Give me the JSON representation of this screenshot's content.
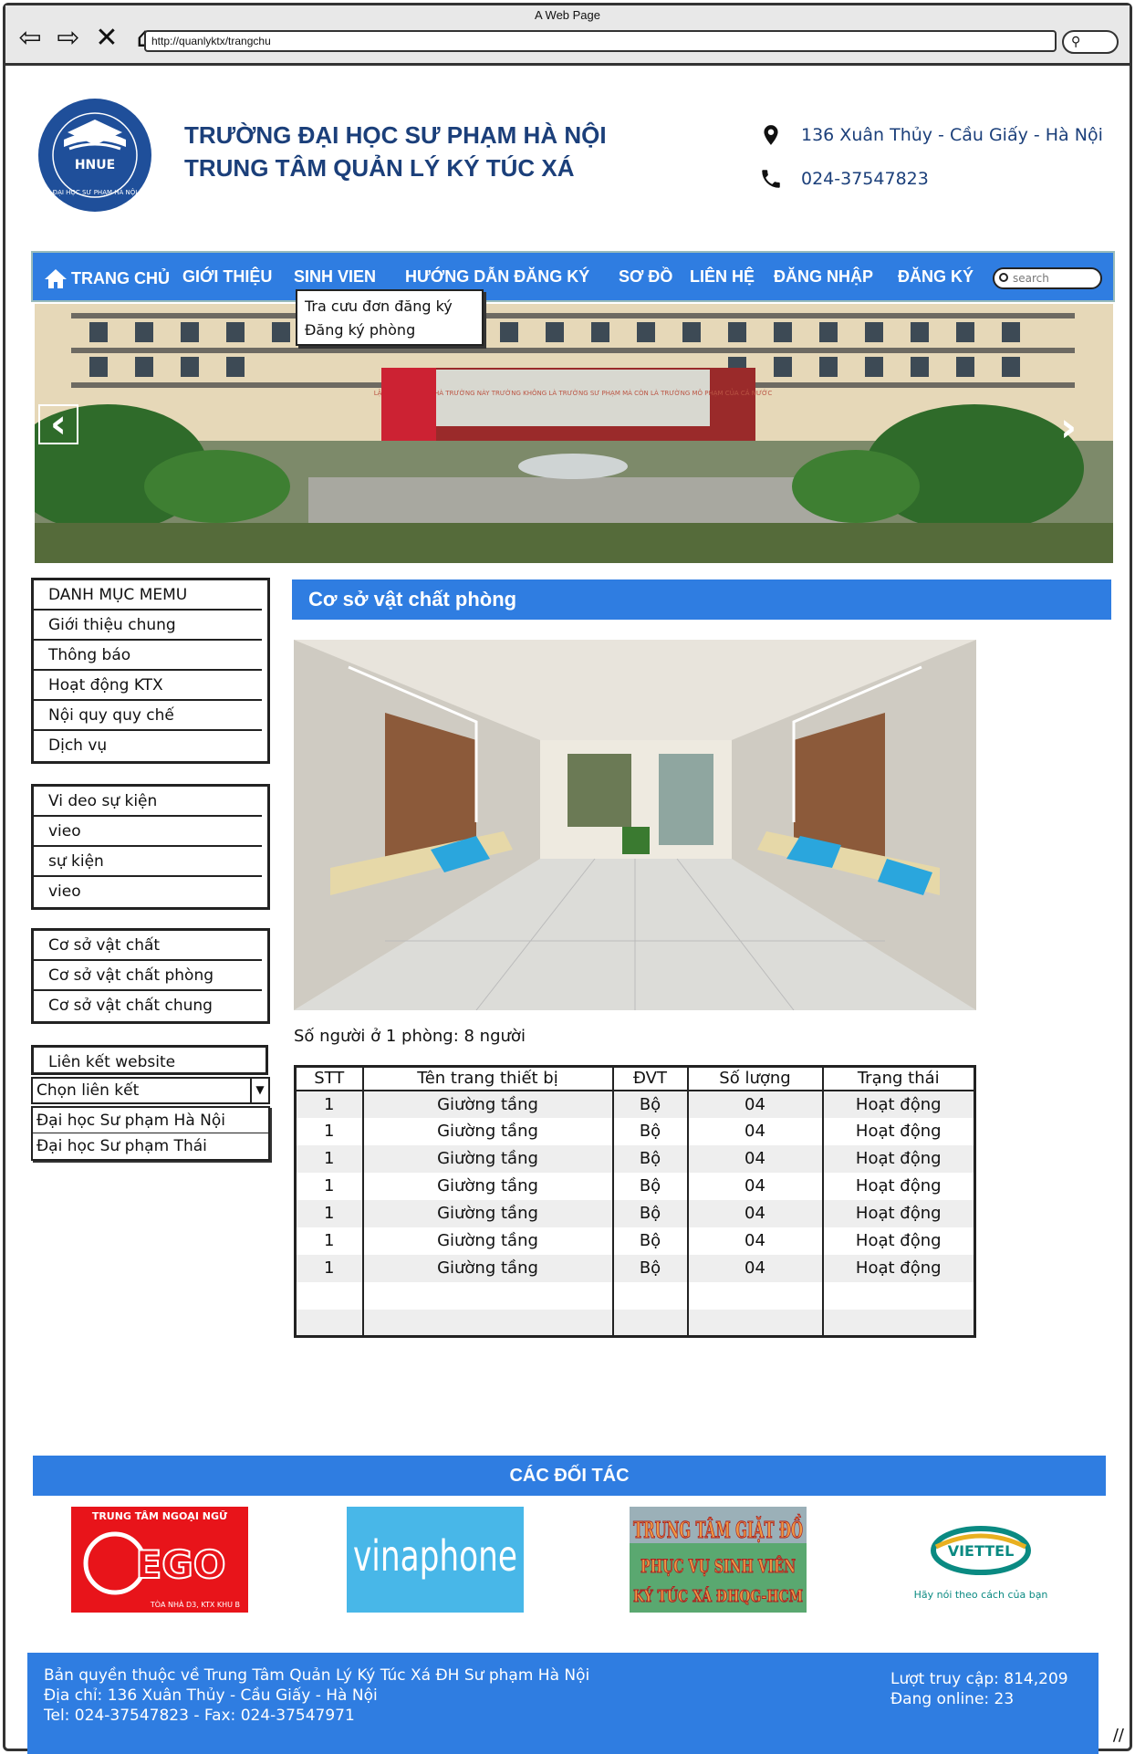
{
  "window": {
    "title": "A Web Page",
    "url": "http://quanlyktx/trangchu",
    "nav_icons": [
      "back-icon",
      "forward-icon",
      "close-icon",
      "home-icon"
    ]
  },
  "header": {
    "school_name": "TRƯỜNG ĐẠI HỌC SƯ PHẠM HÀ NỘI",
    "center_name": "TRUNG TÂM QUẢN LÝ KÝ TÚC XÁ",
    "logo_text": "HNUE",
    "logo_ring_text": "ĐẠI HỌC SƯ PHẠM HÀ NỘI",
    "address": "136 Xuân Thủy - Cầu Giấy - Hà Nội",
    "phone": "024-37547823"
  },
  "nav": {
    "items": [
      "TRANG CHỦ",
      "GIỚI THIỆU",
      "SINH VIEN",
      "HƯỚNG DẪN ĐĂNG KÝ",
      "SƠ ĐỒ",
      "LIÊN HỆ",
      "ĐĂNG NHẬP",
      "ĐĂNG KÝ"
    ],
    "search_placeholder": "search",
    "dropdown": [
      "Tra cưu đơn đăng ký",
      "Đăng ký phòng"
    ]
  },
  "banner": {
    "sign_text": "LẬP THỂ NÀO ĐỂ NHÀ TRƯỜNG NÀY TRƯỜNG KHÔNG LÀ TRƯỜNG SƯ PHẠM MÀ CÒN LÀ TRƯỜNG MÔ PHẠM CỦA CẢ NƯỚC"
  },
  "sidebar": {
    "menu": [
      "DANH MỤC MEMU",
      "Giới thiệu chung",
      "Thông báo",
      "Hoạt động KTX",
      "Nội quy quy chế",
      "Dịch vụ"
    ],
    "video": [
      "Vi deo sự kiện",
      "vieo",
      "sự kiện",
      "vieo"
    ],
    "facilities": [
      "Cơ sở vật chất",
      "Cơ sở vật chất phòng",
      "Cơ sở vật chất chung"
    ],
    "links": {
      "title": "Liên kết website",
      "select_value": "Chọn liên kết",
      "options": [
        "Đại học Sư phạm Hà Nội",
        "Đại học Sư phạm Thái"
      ]
    }
  },
  "content": {
    "title": "Cơ sở vật chất phòng",
    "occupancy": "Số người ở 1 phòng: 8 người",
    "table": {
      "headers": [
        "STT",
        "Tên trang thiết bị",
        "ĐVT",
        "Số lượng",
        "Trạng thái"
      ],
      "rows": [
        [
          "1",
          "Giường tầng",
          "Bộ",
          "04",
          "Hoạt động"
        ],
        [
          "1",
          "Giường tầng",
          "Bộ",
          "04",
          "Hoạt động"
        ],
        [
          "1",
          "Giường tầng",
          "Bộ",
          "04",
          "Hoạt động"
        ],
        [
          "1",
          "Giường tầng",
          "Bộ",
          "04",
          "Hoạt động"
        ],
        [
          "1",
          "Giường tầng",
          "Bộ",
          "04",
          "Hoạt động"
        ],
        [
          "1",
          "Giường tầng",
          "Bộ",
          "04",
          "Hoạt động"
        ],
        [
          "1",
          "Giường tầng",
          "Bộ",
          "04",
          "Hoạt động"
        ]
      ]
    }
  },
  "partners": {
    "title": "CÁC ĐỐI TÁC",
    "items": [
      {
        "line1": "TRUNG TÂM NGOẠI NGỮ",
        "brand": "EGO",
        "line2": "TÒA NHÀ D3, KTX KHU B"
      },
      {
        "brand": "vinaphone"
      },
      {
        "line1": "TRUNG TÂM GIẶT ĐỒ",
        "line2": "PHỤC VỤ SINH VIÊN",
        "line3": "KÝ TÚC XÁ ĐHQG-HCM"
      },
      {
        "brand": "VIETTEL",
        "line2": "Hãy nói theo cách của bạn"
      }
    ]
  },
  "footer": {
    "copyright": "Bản quyền thuộc về Trung Tâm Quản Lý Ký Túc Xá ĐH Sư phạm Hà Nội",
    "address": "Địa chỉ: 136 Xuân Thủy - Cầu Giấy - Hà Nội",
    "phone": "Tel: 024-37547823 - Fax: 024-37547971",
    "visits": "Lượt truy cập: 814,209",
    "online": "Đang online: 23"
  },
  "colors": {
    "accent": "#2f7de1",
    "navy": "#1b3f7a",
    "logo_blue": "#1f4f9a"
  }
}
